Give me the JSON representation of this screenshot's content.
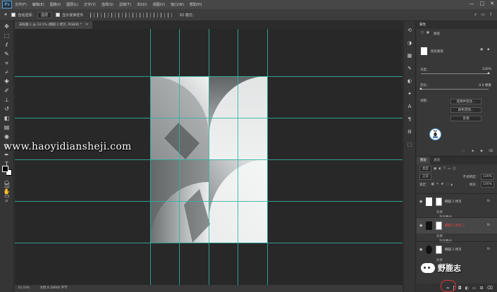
{
  "menu": {
    "logo": "Ps",
    "items": [
      "文件(F)",
      "编辑(E)",
      "图像(I)",
      "图层(L)",
      "文字(Y)",
      "选择(S)",
      "滤镜(T)",
      "3D(D)",
      "视图(V)",
      "窗口(W)",
      "帮助(H)"
    ],
    "controls": [
      "—",
      "□",
      "✕"
    ]
  },
  "options": {
    "auto_select_label": "自动选择：",
    "auto_select_value": "图层",
    "show_transform_label": "显示变换控件",
    "mode_3d": "3D 模式："
  },
  "document": {
    "tab_title": "未标题-1 @ 33.1% (椭圆 2 拷贝, RGB/8) *",
    "close_glyph": "✕"
  },
  "status": {
    "zoom": "33.33%",
    "doc_info": "文档:8.58M/0 字节"
  },
  "watermark": "www.haoyidiansheji.com",
  "properties": {
    "title": "属性",
    "mode_label": "蒙版",
    "pixel_mask_label": "图层蒙版",
    "density_label": "浓度：",
    "density_value": "100%",
    "feather_label": "羽化：",
    "feather_value": "0.0 像素",
    "refine_label": "调整：",
    "select_mask_button": "选择并遮住…",
    "color_range_button": "颜色范围…",
    "invert_button": "反相",
    "density_level": 1.0,
    "feather_level": 0.0
  },
  "layers": {
    "tabs": [
      "图层",
      "通道"
    ],
    "kind_label": "类型",
    "blend_mode": "正常",
    "opacity_label": "不透明度：",
    "opacity_value": "100%",
    "lock_label": "锁定：",
    "fill_label": "填充：",
    "fill_value": "100%",
    "items": [
      {
        "name": "椭圆 2 拷贝",
        "fx": "fx",
        "effects_label": "效果",
        "effect": "渐变叠加"
      },
      {
        "name": "椭圆 2 拷贝 2",
        "fx": "fx",
        "effects_label": "效果",
        "effect": "渐变叠加"
      },
      {
        "name": "椭圆 2 拷贝",
        "fx": "fx",
        "effects_label": "效果",
        "effect": "渐变叠加"
      }
    ]
  },
  "brand": {
    "name": "野鹿志"
  },
  "colors": {
    "guide": "#2fb3a3",
    "canvas_bg": "#282828",
    "accent_red": "#dd3333"
  }
}
